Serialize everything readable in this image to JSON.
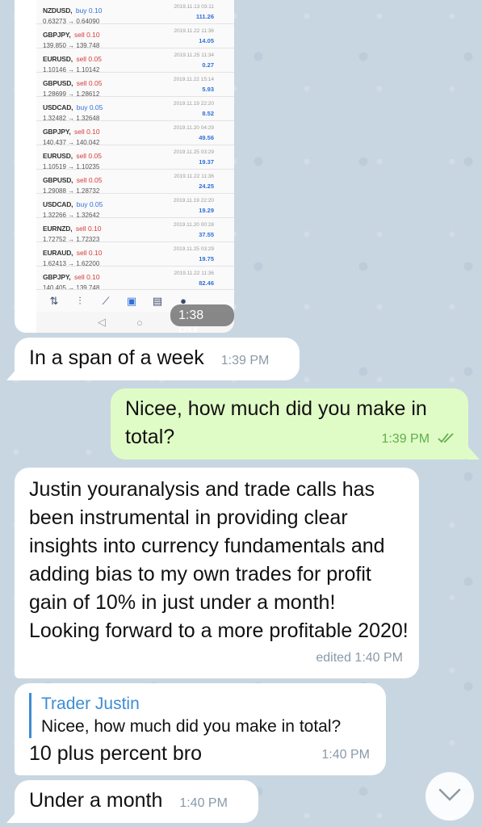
{
  "trade_screenshot": {
    "trades": [
      {
        "symbol": "NZDUSD,",
        "side": "buy 0.10",
        "side_type": "buy",
        "prices": "0.63273 → 0.64090",
        "datetime": "2019.11.13 03:11",
        "profit": "111.26"
      },
      {
        "symbol": "GBPJPY,",
        "side": "sell 0.10",
        "side_type": "sell",
        "prices": "139.850 → 139.748",
        "datetime": "2019.11.22 11:36",
        "profit": "14.05"
      },
      {
        "symbol": "EURUSD,",
        "side": "sell 0.05",
        "side_type": "sell",
        "prices": "1.10146 → 1.10142",
        "datetime": "2019.11.25 11:34",
        "profit": "0.27"
      },
      {
        "symbol": "GBPUSD,",
        "side": "sell 0.05",
        "side_type": "sell",
        "prices": "1.28699 → 1.28612",
        "datetime": "2019.11.22 15:14",
        "profit": "5.93"
      },
      {
        "symbol": "USDCAD,",
        "side": "buy 0.05",
        "side_type": "buy",
        "prices": "1.32482 → 1.32648",
        "datetime": "2019.11.19 22:20",
        "profit": "8.52"
      },
      {
        "symbol": "GBPJPY,",
        "side": "sell 0.10",
        "side_type": "sell",
        "prices": "140.437 → 140.042",
        "datetime": "2019.11.20 04:29",
        "profit": "49.56"
      },
      {
        "symbol": "EURUSD,",
        "side": "sell 0.05",
        "side_type": "sell",
        "prices": "1.10519 → 1.10235",
        "datetime": "2019.11.25 03:29",
        "profit": "19.37"
      },
      {
        "symbol": "GBPUSD,",
        "side": "sell 0.05",
        "side_type": "sell",
        "prices": "1.29088 → 1.28732",
        "datetime": "2019.11.22 11:36",
        "profit": "24.25"
      },
      {
        "symbol": "USDCAD,",
        "side": "buy 0.05",
        "side_type": "buy",
        "prices": "1.32266 → 1.32642",
        "datetime": "2019.11.19 22:20",
        "profit": "19.29"
      },
      {
        "symbol": "EURNZD,",
        "side": "sell 0.10",
        "side_type": "sell",
        "prices": "1.72752 → 1.72323",
        "datetime": "2019.11.20 00:28",
        "profit": "37.55"
      },
      {
        "symbol": "EURAUD,",
        "side": "sell 0.10",
        "side_type": "sell",
        "prices": "1.62413 → 1.62200",
        "datetime": "2019.11.25 03:29",
        "profit": "19.75"
      },
      {
        "symbol": "GBPJPY,",
        "side": "sell 0.10",
        "side_type": "sell",
        "prices": "140.405 → 139.748",
        "datetime": "2019.11.22 11:36",
        "profit": "82.46"
      }
    ],
    "time": "1:38 PM"
  },
  "messages": {
    "m1": {
      "text": "In a span of a week",
      "time": "1:39 PM"
    },
    "m2": {
      "text": "Nicee, how much did you make in total?",
      "time": "1:39 PM"
    },
    "m3": {
      "text": "Justin youranalysis and trade calls has been instrumental in providing clear insights into currency fundamentals and adding bias to my own trades for profit gain of 10% in just under a month! Looking forward to a more profitable 2020!",
      "time": "edited 1:40 PM"
    },
    "m4": {
      "reply_name": "Trader Justin",
      "reply_text": "Nicee, how much did you make in total?",
      "text": "10 plus percent bro",
      "time": "1:40 PM"
    },
    "m5": {
      "text": "Under a month",
      "time": "1:40 PM"
    }
  },
  "colors": {
    "background": "#c8d6e1",
    "incoming_bubble": "#ffffff",
    "outgoing_bubble": "#e0fcc6",
    "reply_accent": "#3d8dd3",
    "read_check": "#5fae4f"
  },
  "icons": {
    "read_receipt": "double-check-icon",
    "scroll_down": "chevron-down-icon"
  }
}
